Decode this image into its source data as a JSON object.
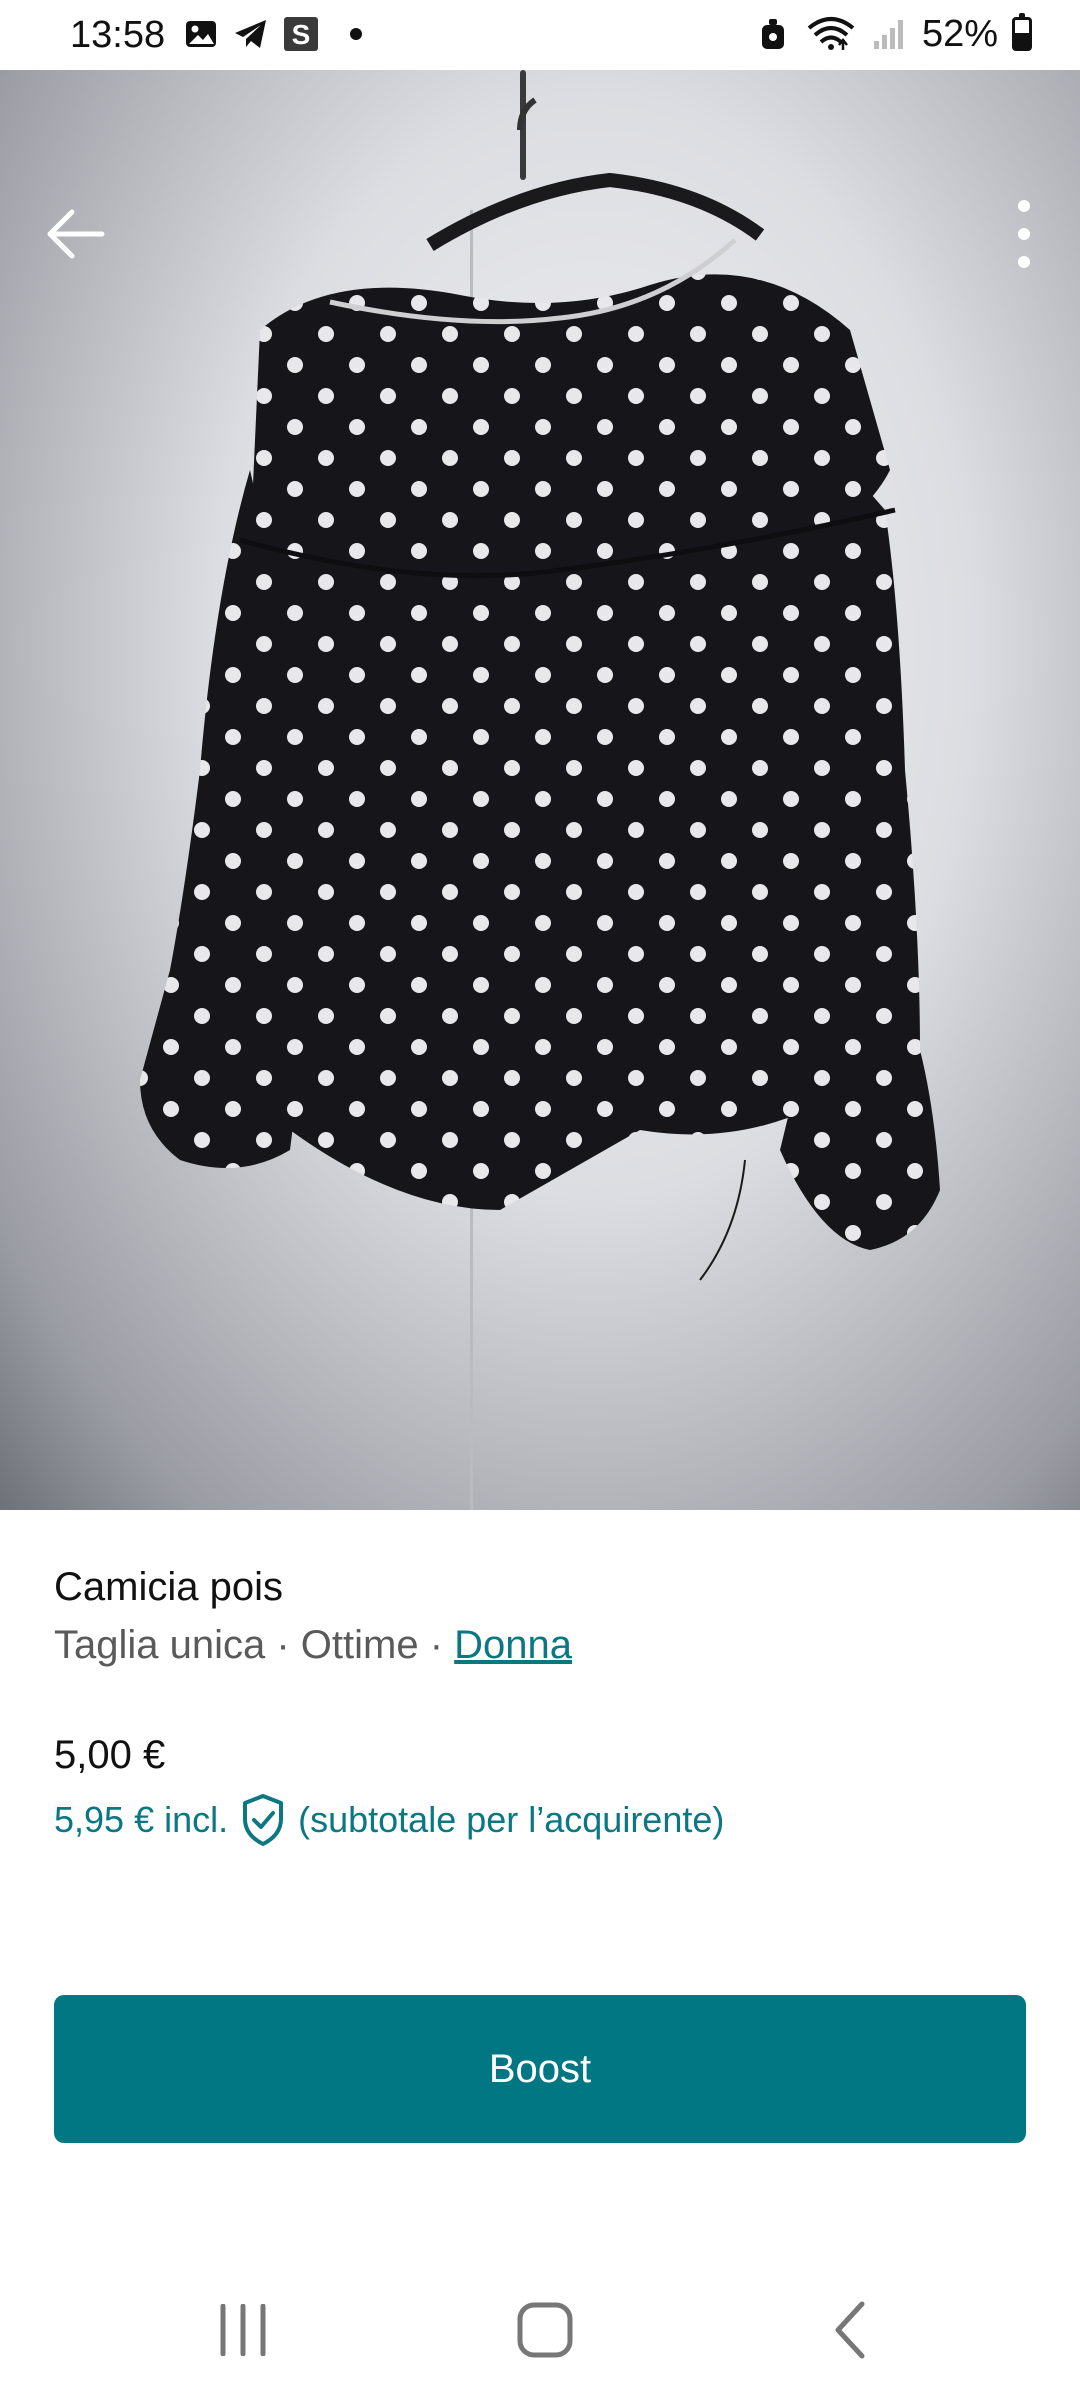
{
  "status_bar": {
    "time": "13:58",
    "battery_percent": "52%",
    "battery_level": 0.52,
    "left_icons": [
      "image-icon",
      "telegram-icon",
      "s-app-icon",
      "dot-icon"
    ],
    "right_icons": [
      "lock-icon",
      "wifi-icon",
      "signal-icon",
      "battery-icon"
    ]
  },
  "toolbar": {
    "back_icon": "arrow-left-icon",
    "more_icon": "more-vertical-icon"
  },
  "item": {
    "title": "Camicia pois",
    "size": "Taglia unica",
    "separator": " · ",
    "condition": "Ottime",
    "category": "Donna",
    "price": "5,00 €",
    "price_incl": "5,95 € incl.",
    "buyer_note": "(subtotale per l’acquirente)"
  },
  "actions": {
    "boost_label": "Boost"
  },
  "nav": {
    "recents_icon": "recent-apps-icon",
    "home_icon": "home-icon",
    "back_icon": "back-icon"
  },
  "colors": {
    "accent": "#007782",
    "link": "#0a7783"
  }
}
